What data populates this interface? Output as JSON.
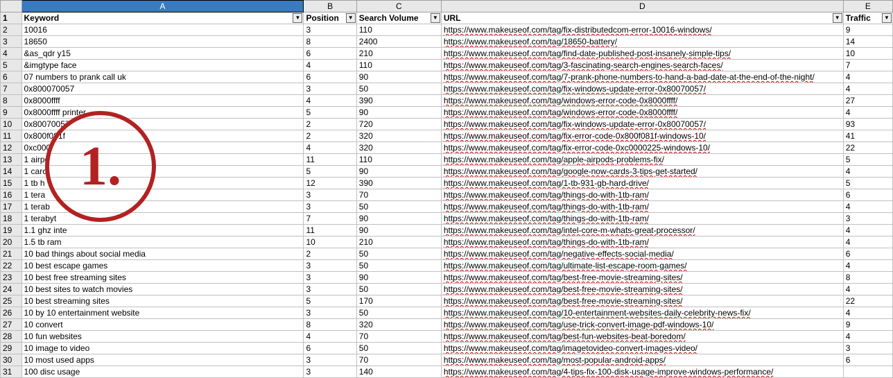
{
  "col_letters": [
    "A",
    "B",
    "C",
    "D",
    "E"
  ],
  "headers": [
    "Keyword",
    "Position",
    "Search Volume",
    "URL",
    "Traffic"
  ],
  "annotation": "1.",
  "rows": [
    {
      "n": "2",
      "k": "10016",
      "knum": true,
      "p": "3",
      "sv": "110",
      "u": "https://www.makeuseof.com/tag/fix-distributedcom-error-10016-windows/",
      "t": "9"
    },
    {
      "n": "3",
      "k": "18650",
      "knum": true,
      "p": "8",
      "sv": "2400",
      "u": "https://www.makeuseof.com/tag/18650-battery/",
      "t": "14"
    },
    {
      "n": "4",
      "k": "&as_qdr y15",
      "p": "6",
      "sv": "210",
      "u": "https://www.makeuseof.com/tag/find-date-published-post-insanely-simple-tips/",
      "t": "10"
    },
    {
      "n": "5",
      "k": "&imgtype face",
      "p": "4",
      "sv": "110",
      "u": "https://www.makeuseof.com/tag/3-fascinating-search-engines-search-faces/",
      "t": "7"
    },
    {
      "n": "6",
      "k": "07 numbers to prank call uk",
      "p": "6",
      "sv": "90",
      "u": "https://www.makeuseof.com/tag/7-prank-phone-numbers-to-hand-a-bad-date-at-the-end-of-the-night/",
      "t": "4"
    },
    {
      "n": "7",
      "k": "0x800070057",
      "p": "3",
      "sv": "50",
      "u": "https://www.makeuseof.com/tag/fix-windows-update-error-0x80070057/",
      "t": "4"
    },
    {
      "n": "8",
      "k": "0x8000ffff",
      "p": "4",
      "sv": "390",
      "u": "https://www.makeuseof.com/tag/windows-error-code-0x8000ffff/",
      "t": "27"
    },
    {
      "n": "9",
      "k": "0x8000ffff printer",
      "p": "5",
      "sv": "90",
      "u": "https://www.makeuseof.com/tag/windows-error-code-0x8000ffff/",
      "t": "4"
    },
    {
      "n": "10",
      "k": "0x80070057",
      "p": "2",
      "sv": "720",
      "u": "https://www.makeuseof.com/tag/fix-windows-update-error-0x80070057/",
      "t": "93"
    },
    {
      "n": "11",
      "k": "0x800f081f",
      "p": "2",
      "sv": "320",
      "u": "https://www.makeuseof.com/tag/fix-error-code-0x800f081f-windows-10/",
      "t": "41"
    },
    {
      "n": "12",
      "k": "0xc000",
      "p": "4",
      "sv": "320",
      "u": "https://www.makeuseof.com/tag/fix-error-code-0xc0000225-windows-10/",
      "t": "22"
    },
    {
      "n": "13",
      "k": "1 airpo",
      "p": "11",
      "sv": "110",
      "u": "https://www.makeuseof.com/tag/apple-airpods-problems-fix/",
      "t": "5"
    },
    {
      "n": "14",
      "k": "1 carc",
      "p": "5",
      "sv": "90",
      "u": "https://www.makeuseof.com/tag/google-now-cards-3-tips-get-started/",
      "t": "4"
    },
    {
      "n": "15",
      "k": "1 tb h",
      "p": "12",
      "sv": "390",
      "u": "https://www.makeuseof.com/tag/1-tb-931-gb-hard-drive/",
      "t": "5"
    },
    {
      "n": "16",
      "k": "1 tera",
      "p": "3",
      "sv": "70",
      "u": "https://www.makeuseof.com/tag/things-do-with-1tb-ram/",
      "t": "6"
    },
    {
      "n": "17",
      "k": "1 terab",
      "p": "3",
      "sv": "50",
      "u": "https://www.makeuseof.com/tag/things-do-with-1tb-ram/",
      "t": "4"
    },
    {
      "n": "18",
      "k": "1 terabyt",
      "p": "7",
      "sv": "90",
      "u": "https://www.makeuseof.com/tag/things-do-with-1tb-ram/",
      "t": "3"
    },
    {
      "n": "19",
      "k": "1.1 ghz inte",
      "p": "11",
      "sv": "90",
      "u": "https://www.makeuseof.com/tag/intel-core-m-whats-great-processor/",
      "t": "4"
    },
    {
      "n": "20",
      "k": "1.5 tb ram",
      "p": "10",
      "sv": "210",
      "u": "https://www.makeuseof.com/tag/things-do-with-1tb-ram/",
      "t": "4"
    },
    {
      "n": "21",
      "k": "10 bad things about social media",
      "p": "2",
      "sv": "50",
      "u": "https://www.makeuseof.com/tag/negative-effects-social-media/",
      "t": "6"
    },
    {
      "n": "22",
      "k": "10 best escape games",
      "p": "3",
      "sv": "50",
      "u": "https://www.makeuseof.com/tag/ultimate-list-escape-room-games/",
      "t": "4"
    },
    {
      "n": "23",
      "k": "10 best free streaming sites",
      "p": "3",
      "sv": "90",
      "u": "https://www.makeuseof.com/tag/best-free-movie-streaming-sites/",
      "t": "8"
    },
    {
      "n": "24",
      "k": "10 best sites to watch movies",
      "p": "3",
      "sv": "50",
      "u": "https://www.makeuseof.com/tag/best-free-movie-streaming-sites/",
      "t": "4"
    },
    {
      "n": "25",
      "k": "10 best streaming sites",
      "p": "5",
      "sv": "170",
      "u": "https://www.makeuseof.com/tag/best-free-movie-streaming-sites/",
      "t": "22"
    },
    {
      "n": "26",
      "k": "10 by 10 entertainment website",
      "p": "3",
      "sv": "50",
      "u": "https://www.makeuseof.com/tag/10-entertainment-websites-daily-celebrity-news-fix/",
      "t": "4"
    },
    {
      "n": "27",
      "k": "10 convert",
      "p": "8",
      "sv": "320",
      "u": "https://www.makeuseof.com/tag/use-trick-convert-image-pdf-windows-10/",
      "t": "9"
    },
    {
      "n": "28",
      "k": "10 fun websites",
      "p": "4",
      "sv": "70",
      "u": "https://www.makeuseof.com/tag/best-fun-websites-beat-boredom/",
      "t": "4"
    },
    {
      "n": "29",
      "k": "10 image to video",
      "p": "6",
      "sv": "50",
      "u": "https://www.makeuseof.com/tag/imagetovideo-convert-images-video/",
      "t": "3"
    },
    {
      "n": "30",
      "k": "10 most used apps",
      "p": "3",
      "sv": "70",
      "u": "https://www.makeuseof.com/tag/most-popular-android-apps/",
      "t": "6"
    },
    {
      "n": "31",
      "k": "100 disc usage",
      "p": "3",
      "sv": "140",
      "u": "https://www.makeuseof.com/tag/4-tips-fix-100-disk-usage-improve-windows-performance/",
      "t": ""
    }
  ]
}
